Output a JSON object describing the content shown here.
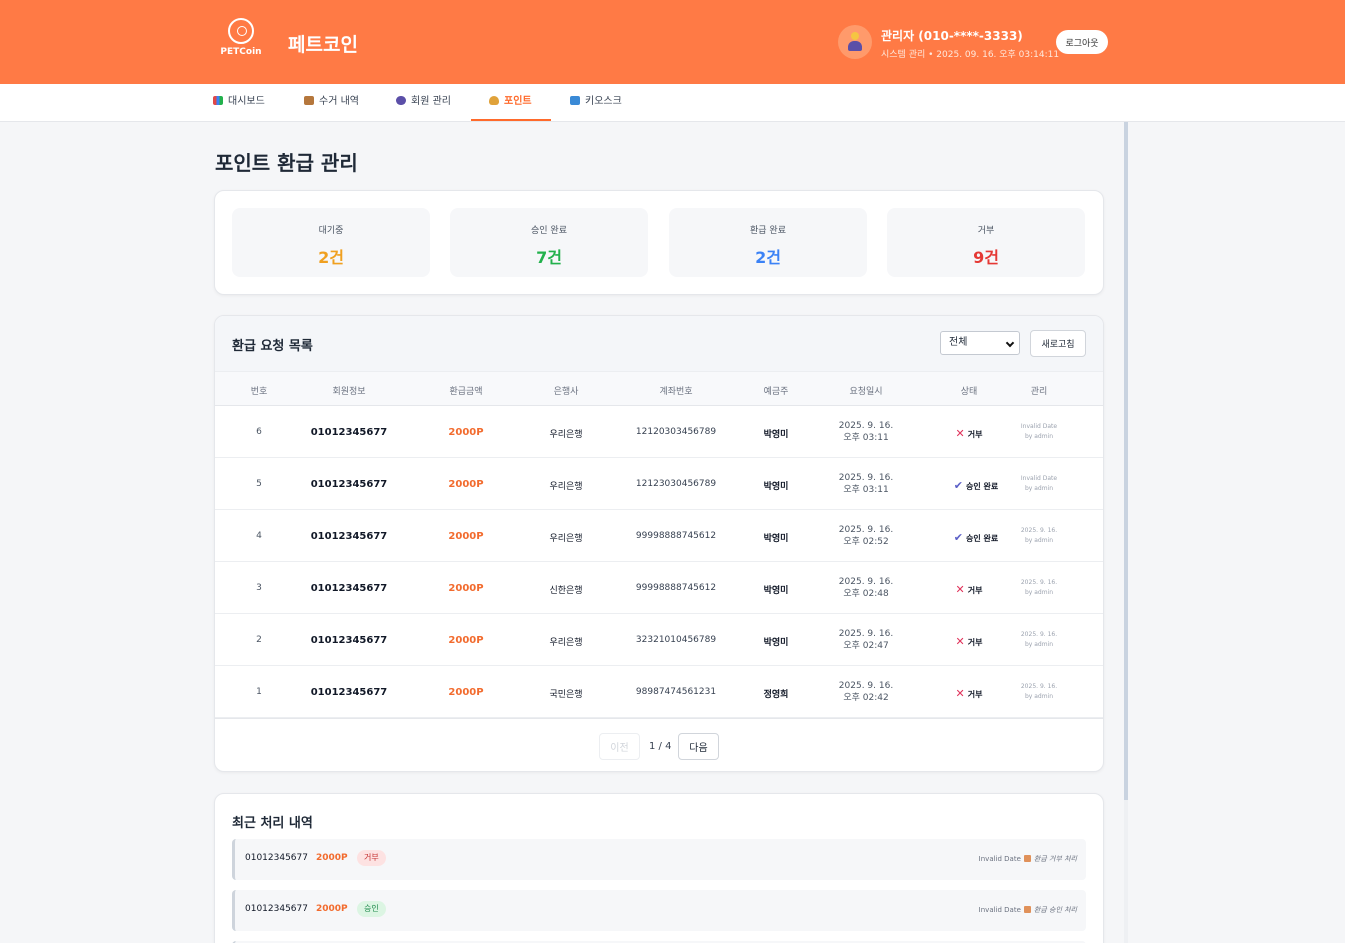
{
  "app": {
    "logo_text": "PETCoin",
    "title": "페트코인"
  },
  "user": {
    "name": "관리자 (010-****-3333)",
    "subtitle": "시스템 관리 • 2025. 09. 16. 오후 03:14:11",
    "logout_label": "로그아웃"
  },
  "nav": [
    {
      "label": "대시보드",
      "icon": "chart-icon",
      "active": false
    },
    {
      "label": "수거 내역",
      "icon": "box-icon",
      "active": false
    },
    {
      "label": "회원 관리",
      "icon": "people-icon",
      "active": false
    },
    {
      "label": "포인트",
      "icon": "money-bag-icon",
      "active": true
    },
    {
      "label": "키오스크",
      "icon": "monitor-icon",
      "active": false
    }
  ],
  "page": {
    "title": "포인트 환급 관리"
  },
  "stats": [
    {
      "label": "대기중",
      "value": "2건",
      "color": "#f0a020"
    },
    {
      "label": "승인 완료",
      "value": "7건",
      "color": "#22b14c"
    },
    {
      "label": "환급 완료",
      "value": "2건",
      "color": "#3b82f6"
    },
    {
      "label": "거부",
      "value": "9건",
      "color": "#e53935"
    }
  ],
  "list": {
    "title": "환급 요청 목록",
    "filter_value": "전체",
    "refresh_label": "새로고침",
    "columns": [
      "번호",
      "회원정보",
      "환급금액",
      "은행사",
      "계좌번호",
      "예금주",
      "요청일시",
      "상태",
      "관리"
    ],
    "rows": [
      {
        "num": "6",
        "member": "01012345677",
        "amount": "2000P",
        "bank": "우리은행",
        "account": "12120303456789",
        "holder": "박영미",
        "date1": "2025. 9. 16.",
        "date2": "오후 03:11",
        "status": "거부",
        "status_type": "reject",
        "manage1": "Invalid Date",
        "manage2": "by admin"
      },
      {
        "num": "5",
        "member": "01012345677",
        "amount": "2000P",
        "bank": "우리은행",
        "account": "12123030456789",
        "holder": "박영미",
        "date1": "2025. 9. 16.",
        "date2": "오후 03:11",
        "status": "승인 완료",
        "status_type": "approve",
        "manage1": "Invalid Date",
        "manage2": "by admin"
      },
      {
        "num": "4",
        "member": "01012345677",
        "amount": "2000P",
        "bank": "우리은행",
        "account": "99998888745612",
        "holder": "박영미",
        "date1": "2025. 9. 16.",
        "date2": "오후 02:52",
        "status": "승인 완료",
        "status_type": "approve",
        "manage1": "2025. 9. 16.",
        "manage2": "by admin"
      },
      {
        "num": "3",
        "member": "01012345677",
        "amount": "2000P",
        "bank": "신한은행",
        "account": "99998888745612",
        "holder": "박영미",
        "date1": "2025. 9. 16.",
        "date2": "오후 02:48",
        "status": "거부",
        "status_type": "reject",
        "manage1": "2025. 9. 16.",
        "manage2": "by admin"
      },
      {
        "num": "2",
        "member": "01012345677",
        "amount": "2000P",
        "bank": "우리은행",
        "account": "32321010456789",
        "holder": "박영미",
        "date1": "2025. 9. 16.",
        "date2": "오후 02:47",
        "status": "거부",
        "status_type": "reject",
        "manage1": "2025. 9. 16.",
        "manage2": "by admin"
      },
      {
        "num": "1",
        "member": "01012345677",
        "amount": "2000P",
        "bank": "국민은행",
        "account": "98987474561231",
        "holder": "정영희",
        "date1": "2025. 9. 16.",
        "date2": "오후 02:42",
        "status": "거부",
        "status_type": "reject",
        "manage1": "2025. 9. 16.",
        "manage2": "by admin"
      }
    ],
    "pager": {
      "prev_label": "이전",
      "info": "1 / 4",
      "next_label": "다음"
    }
  },
  "recent": {
    "title": "최근 처리 내역",
    "items": [
      {
        "member": "01012345677",
        "amount": "2000P",
        "badge": "거부",
        "badge_type": "reject",
        "date": "Invalid Date",
        "note": "환급 거부 처리"
      },
      {
        "member": "01012345677",
        "amount": "2000P",
        "badge": "승인",
        "badge_type": "approve",
        "date": "Invalid Date",
        "note": "환급 승인 처리"
      }
    ]
  },
  "colors": {
    "brand": "#ff7a45",
    "accent": "#ff6a2b"
  }
}
